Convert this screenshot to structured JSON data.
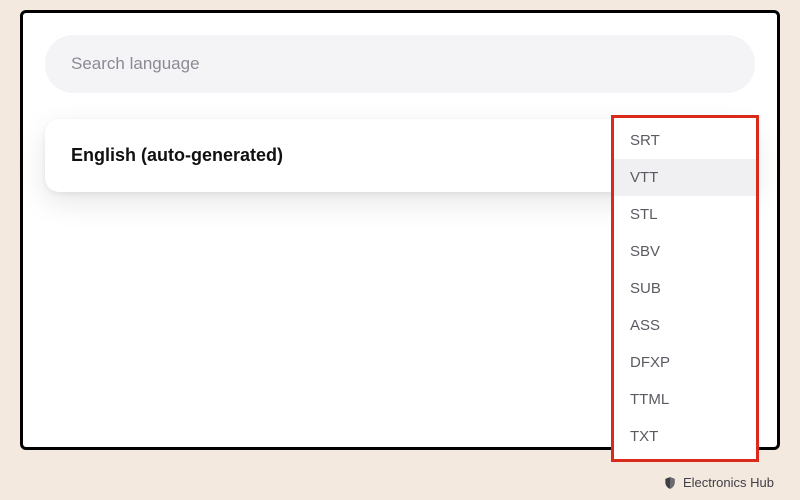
{
  "search": {
    "placeholder": "Search language"
  },
  "language": {
    "label": "English (auto-generated)"
  },
  "formats": {
    "options": [
      "SRT",
      "VTT",
      "STL",
      "SBV",
      "SUB",
      "ASS",
      "DFXP",
      "TTML",
      "TXT"
    ],
    "hover_index": 1
  },
  "watermark": {
    "text": "Electronics Hub"
  },
  "colors": {
    "highlight_border": "#d92a1c",
    "page_bg": "#f3e9de"
  }
}
